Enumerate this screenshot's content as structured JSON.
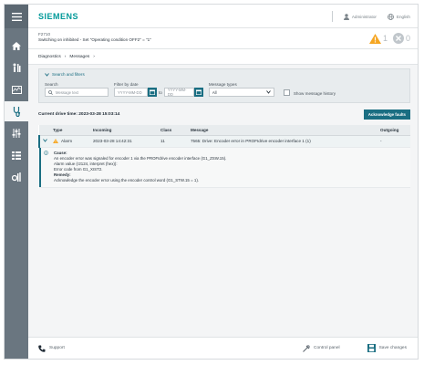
{
  "header": {
    "logo": "SIEMENS",
    "user_label": "Administrator",
    "language_label": "English"
  },
  "alarm_banner": {
    "code": "F2710",
    "text": "Switching on inhibited - Set \"Operating condition OFF2\" = \"1\"",
    "warning_count": "1",
    "fault_count": "0"
  },
  "breadcrumb": {
    "items": [
      "Diagnostics",
      "Messages"
    ]
  },
  "filter": {
    "toggle_label": "Search and filters",
    "search_label": "Search",
    "search_placeholder": "Message text",
    "date_label": "Filter by date",
    "date_from_placeholder": "YYYY-MM-DD",
    "date_to_word": "to",
    "date_to_placeholder": "YYYY-MM-DD",
    "type_label": "Message types",
    "type_value": "All",
    "history_label": "Show message history"
  },
  "drive": {
    "time_label": "Current drive time: 2023-03-28 15:03:14",
    "ack_button": "Acknowledge faults"
  },
  "table": {
    "headers": [
      "",
      "Type",
      "Incoming",
      "Class",
      "Message",
      "Outgoing"
    ],
    "rows": [
      {
        "type": "Alarm",
        "incoming": "2023-03-28 14:42:31",
        "class": "11",
        "message": "7565: Drive: Encoder error in PROFIdrive encoder interface 1 (1)",
        "outgoing": "-"
      }
    ],
    "detail": {
      "cause_heading": "Cause:",
      "cause_lines": [
        "An encoder error was signaled for encoder 1 via the PROFIdrive encoder interface (G1_ZSW.15).",
        "Alarm value (r2124, interpret (hex)):",
        "Error code from G1_XIST2."
      ],
      "remedy_heading": "Remedy:",
      "remedy_lines": [
        "Acknowledge the encoder error using the encoder control word (G1_STW.15 = 1)."
      ]
    }
  },
  "footer": {
    "support_label": "Support",
    "control_panel_label": "Control panel",
    "save_label": "Save changes"
  },
  "colors": {
    "accent": "#1a6e82",
    "brand": "#009999",
    "warning": "#f5a623",
    "rail": "#6a7680"
  }
}
